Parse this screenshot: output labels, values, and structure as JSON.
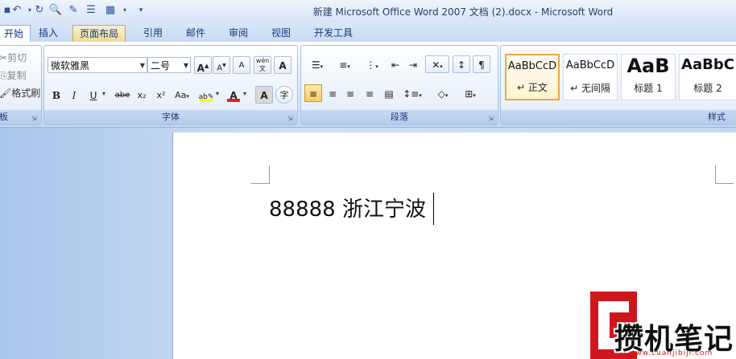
{
  "window": {
    "title": "新建 Microsoft Office Word 2007 文档 (2).docx - Microsoft Word",
    "quick_access": [
      "save-icon",
      "undo-icon",
      "redo-icon",
      "print-preview-icon",
      "edit-icon",
      "paragraph-icon",
      "table-icon",
      "customize-icon"
    ]
  },
  "tabs": [
    {
      "label": "开始"
    },
    {
      "label": "插入"
    },
    {
      "label": "页面布局"
    },
    {
      "label": "引用"
    },
    {
      "label": "邮件"
    },
    {
      "label": "审阅"
    },
    {
      "label": "视图"
    },
    {
      "label": "开发工具"
    }
  ],
  "clipboard": {
    "cut": "剪切",
    "copy": "复制",
    "format_painter": "格式刷",
    "title": "板"
  },
  "font": {
    "name": "微软雅黑",
    "size": "二号",
    "title": "字体",
    "bold": "B",
    "italic": "I",
    "underline": "U",
    "strike": "abe",
    "sub": "x₂",
    "sup": "x²",
    "case": "Aa",
    "grow": "A",
    "shrink": "A",
    "clear": "A",
    "phonetic": "wén",
    "border_char": "A",
    "font_color": "A",
    "shade": "A",
    "enclose": "字"
  },
  "paragraph": {
    "title": "段落"
  },
  "styles": {
    "title": "样式",
    "items": [
      {
        "sample": "AaBbCcD",
        "label": "↵ 正文"
      },
      {
        "sample": "AaBbCcD",
        "label": "↵ 无间隔"
      },
      {
        "sample": "AaB",
        "label": "标题 1"
      },
      {
        "sample": "AaBbC",
        "label": "标题 2"
      }
    ]
  },
  "document": {
    "text": "88888 浙江宁波"
  },
  "watermark": {
    "text": "攒机笔记",
    "url": "www.cuanjibiji.com"
  },
  "colors": {
    "accent": "#e8a845",
    "font_color_bar": "#e02020",
    "highlight_bar": "#ffff00",
    "logo_red": "#d0161d"
  }
}
